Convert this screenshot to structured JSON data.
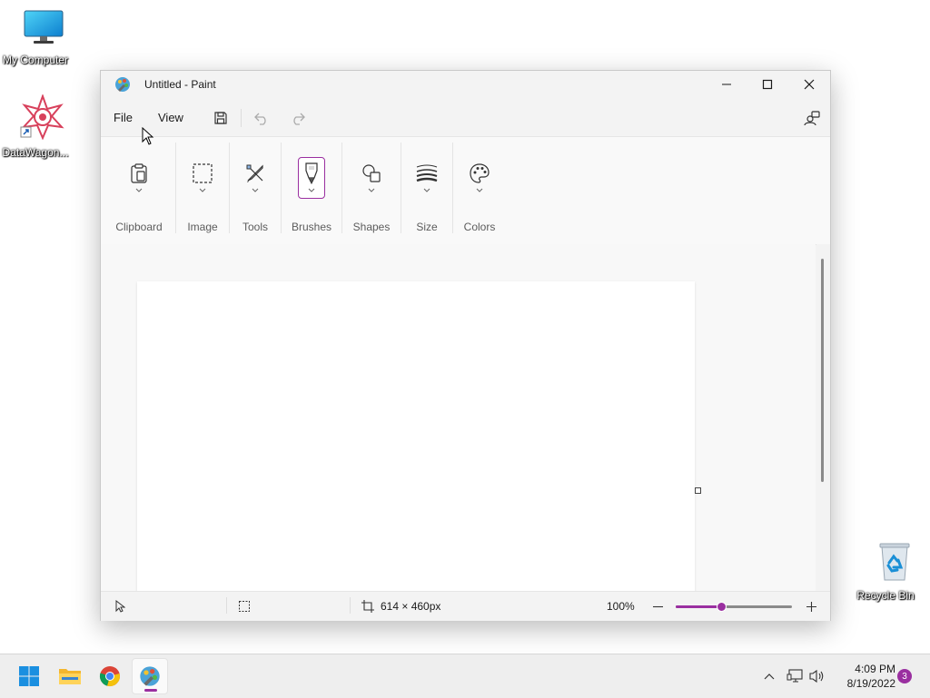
{
  "desktop": {
    "icons": [
      {
        "label": "My Computer"
      },
      {
        "label": "DataWagon..."
      },
      {
        "label": "Recycle Bin"
      }
    ]
  },
  "window": {
    "title": "Untitled - Paint",
    "menu": {
      "file": "File",
      "view": "View"
    },
    "ribbon": {
      "groups": [
        {
          "label": "Clipboard",
          "icon": "clipboard-icon"
        },
        {
          "label": "Image",
          "icon": "selection-icon"
        },
        {
          "label": "Tools",
          "icon": "tools-icon"
        },
        {
          "label": "Brushes",
          "icon": "brush-icon"
        },
        {
          "label": "Shapes",
          "icon": "shapes-icon"
        },
        {
          "label": "Size",
          "icon": "stroke-size-icon"
        },
        {
          "label": "Colors",
          "icon": "palette-icon"
        }
      ]
    },
    "status": {
      "canvas_size": "614 × 460px",
      "zoom_label": "100%",
      "zoom_fraction": 0.39
    }
  },
  "taskbar": {
    "time": "4:09 PM",
    "date": "8/19/2022",
    "notification_count": "3"
  },
  "colors": {
    "accent": "#9a2fa0"
  }
}
